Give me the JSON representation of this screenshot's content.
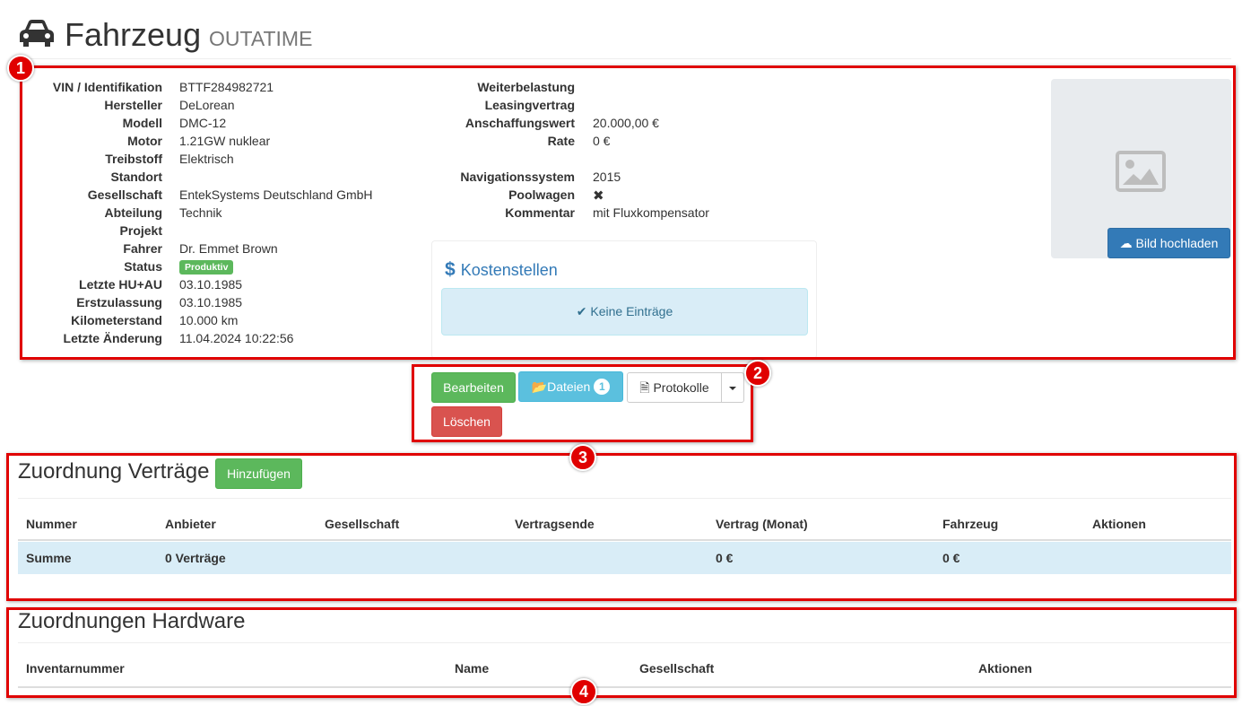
{
  "header": {
    "title": "Fahrzeug",
    "subtitle": "OUTATIME"
  },
  "vehicle_details_left": [
    {
      "label": "VIN / Identifikation",
      "value": "BTTF284982721"
    },
    {
      "label": "Hersteller",
      "value": "DeLorean"
    },
    {
      "label": "Modell",
      "value": "DMC-12"
    },
    {
      "label": "Motor",
      "value": "1.21GW nuklear"
    },
    {
      "label": "Treibstoff",
      "value": "Elektrisch"
    },
    {
      "label": "Standort",
      "value": ""
    },
    {
      "label": "Gesellschaft",
      "value": "EntekSystems Deutschland GmbH"
    },
    {
      "label": "Abteilung",
      "value": "Technik"
    },
    {
      "label": "Projekt",
      "value": ""
    },
    {
      "label": "Fahrer",
      "value": "Dr. Emmet Brown"
    },
    {
      "label": "Status",
      "value": "Produktiv"
    },
    {
      "label": "Letzte HU+AU",
      "value": "03.10.1985"
    },
    {
      "label": "Erstzulassung",
      "value": "03.10.1985"
    },
    {
      "label": "Kilometerstand",
      "value": "10.000 km"
    },
    {
      "label": "Letzte Änderung",
      "value": "11.04.2024 10:22:56"
    }
  ],
  "vehicle_details_right": [
    {
      "label": "Weiterbelastung",
      "value": ""
    },
    {
      "label": "Leasingvertrag",
      "value": ""
    },
    {
      "label": "Anschaffungswert",
      "value": "20.000,00 €"
    },
    {
      "label": "Rate",
      "value": "0 €"
    },
    {
      "label": "Navigationssystem",
      "value": "2015"
    },
    {
      "label": "Poolwagen",
      "value": "✖"
    },
    {
      "label": "Kommentar",
      "value": "mit Fluxkompensator"
    }
  ],
  "image_panel": {
    "upload_label": "Bild hochladen"
  },
  "cost_centers": {
    "title": "Kostenstellen",
    "empty_text": "Keine Einträge"
  },
  "actions": {
    "edit_label": "Bearbeiten",
    "files_label": "Dateien",
    "files_count": "1",
    "protocols_label": "Protokolle",
    "delete_label": "Löschen"
  },
  "contracts": {
    "title": "Zuordnung Verträge",
    "add_label": "Hinzufügen",
    "columns": [
      "Nummer",
      "Anbieter",
      "Gesellschaft",
      "Vertragsende",
      "Vertrag (Monat)",
      "Fahrzeug",
      "Aktionen"
    ],
    "summary_row": {
      "label": "Summe",
      "count": "0 Verträge",
      "monthly": "0 €",
      "vehicle": "0 €"
    }
  },
  "hardware": {
    "title": "Zuordnungen Hardware",
    "columns": [
      "Inventarnummer",
      "Name",
      "Gesellschaft",
      "Aktionen"
    ]
  },
  "annotations": [
    "1",
    "2",
    "3",
    "4"
  ],
  "colors": {
    "annotation_red": "#e00000",
    "primary": "#337ab7",
    "success": "#5cb85c",
    "info": "#5bc0de",
    "danger": "#d9534f",
    "summary_row_bg": "#d9edf7"
  }
}
